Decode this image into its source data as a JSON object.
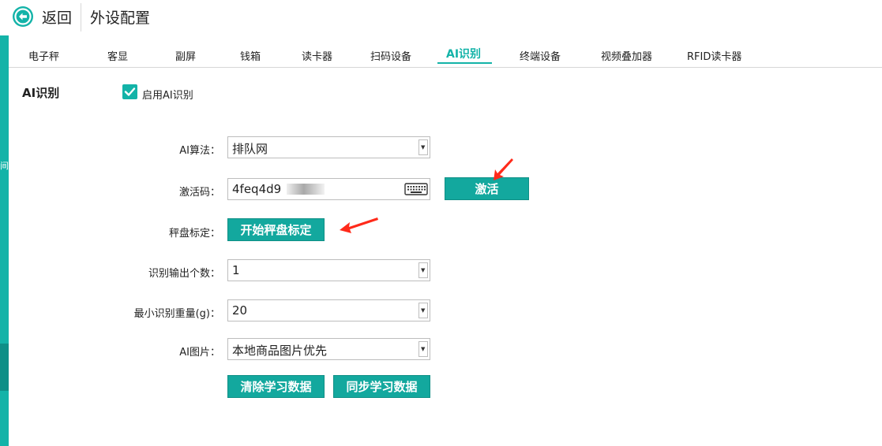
{
  "header": {
    "back_label": "返回",
    "title": "外设配置"
  },
  "tabs": [
    {
      "label": "电子秤"
    },
    {
      "label": "客显"
    },
    {
      "label": "副屏"
    },
    {
      "label": "钱箱"
    },
    {
      "label": "读卡器"
    },
    {
      "label": "扫码设备"
    },
    {
      "label": "AI识别",
      "active": true
    },
    {
      "label": "终端设备"
    },
    {
      "label": "视频叠加器"
    },
    {
      "label": "RFID读卡器"
    }
  ],
  "left_strip": {
    "partial_char": "间"
  },
  "section": {
    "title": "AI识别",
    "enable_checkbox": {
      "label": "启用AI识别",
      "checked": true
    }
  },
  "form": {
    "algorithm": {
      "label": "AI算法：",
      "value": "排队网"
    },
    "activation": {
      "label": "激活码：",
      "value": "4feq4d9",
      "button": "激活"
    },
    "calibration": {
      "label": "秤盘标定：",
      "button": "开始秤盘标定"
    },
    "output_count": {
      "label": "识别输出个数：",
      "value": "1"
    },
    "min_weight": {
      "label": "最小识别重量(g)：",
      "value": "20"
    },
    "ai_image": {
      "label": "AI图片：",
      "value": "本地商品图片优先"
    },
    "clear_button": "清除学习数据",
    "sync_button": "同步学习数据"
  },
  "colors": {
    "accent": "#13b3a8",
    "button": "#13a89e",
    "arrow": "#ff2a1a"
  },
  "icons": [
    "back-arrow-icon",
    "checkmark-icon",
    "keyboard-icon",
    "chevron-down-icon",
    "red-arrow-annotation"
  ]
}
